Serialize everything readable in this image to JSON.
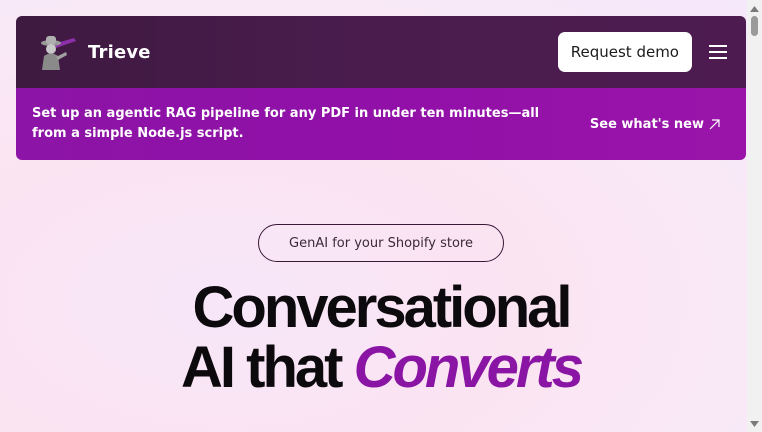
{
  "header": {
    "brand": "Trieve",
    "request_demo_label": "Request demo"
  },
  "banner": {
    "text": "Set up an agentic RAG pipeline for any PDF in under ten minutes—all from a simple Node.js script.",
    "link_label": "See what's new",
    "link_icon": "arrow-up-right-icon"
  },
  "hero": {
    "pill_label": "GenAI for your Shopify store",
    "line1": "Conversational",
    "line2_prefix": "AI that ",
    "line2_accent": "Converts"
  },
  "colors": {
    "topbar": "#4a1c4e",
    "banner": "#9110a8",
    "accent": "#8a14a4"
  },
  "icons": [
    "trieve-logo-icon",
    "hamburger-menu-icon",
    "arrow-up-right-icon"
  ]
}
